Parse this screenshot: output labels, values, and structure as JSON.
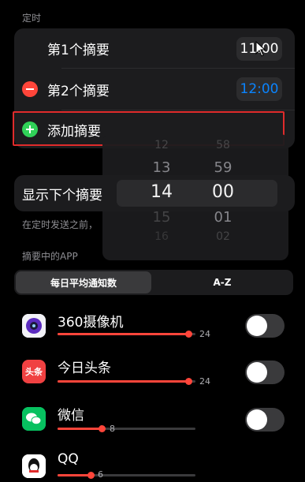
{
  "schedule": {
    "header": "定时",
    "summaries": [
      {
        "label": "第1个摘要",
        "time": "11:00"
      },
      {
        "label": "第2个摘要",
        "time": "12:00"
      }
    ],
    "add_label": "添加摘要"
  },
  "next_summary": {
    "label": "显示下个摘要",
    "footer": "在定时发送之前，"
  },
  "picker": {
    "hours": [
      "12",
      "13",
      "14",
      "15",
      "16"
    ],
    "minutes": [
      "58",
      "59",
      "00",
      "01",
      "02"
    ]
  },
  "apps_section": {
    "header": "摘要中的APP",
    "sort": {
      "option_daily": "每日平均通知数",
      "option_az": "A-Z"
    },
    "apps": [
      {
        "name": "360摄像机",
        "count": "24",
        "icon": "360-camera-icon",
        "level": 0.95,
        "enabled": false
      },
      {
        "name": "今日头条",
        "count": "24",
        "icon": "toutiao-icon",
        "icon_text": "头条",
        "level": 0.95,
        "enabled": false
      },
      {
        "name": "微信",
        "count": "8",
        "icon": "wechat-icon",
        "level": 0.32,
        "enabled": false
      },
      {
        "name": "QQ",
        "count": "6",
        "icon": "qq-icon",
        "level": 0.24,
        "enabled": false
      }
    ]
  },
  "colors": {
    "accent": "#0a84ff",
    "destructive": "#ff453a",
    "add": "#30d158",
    "highlight": "#e02b2b"
  }
}
